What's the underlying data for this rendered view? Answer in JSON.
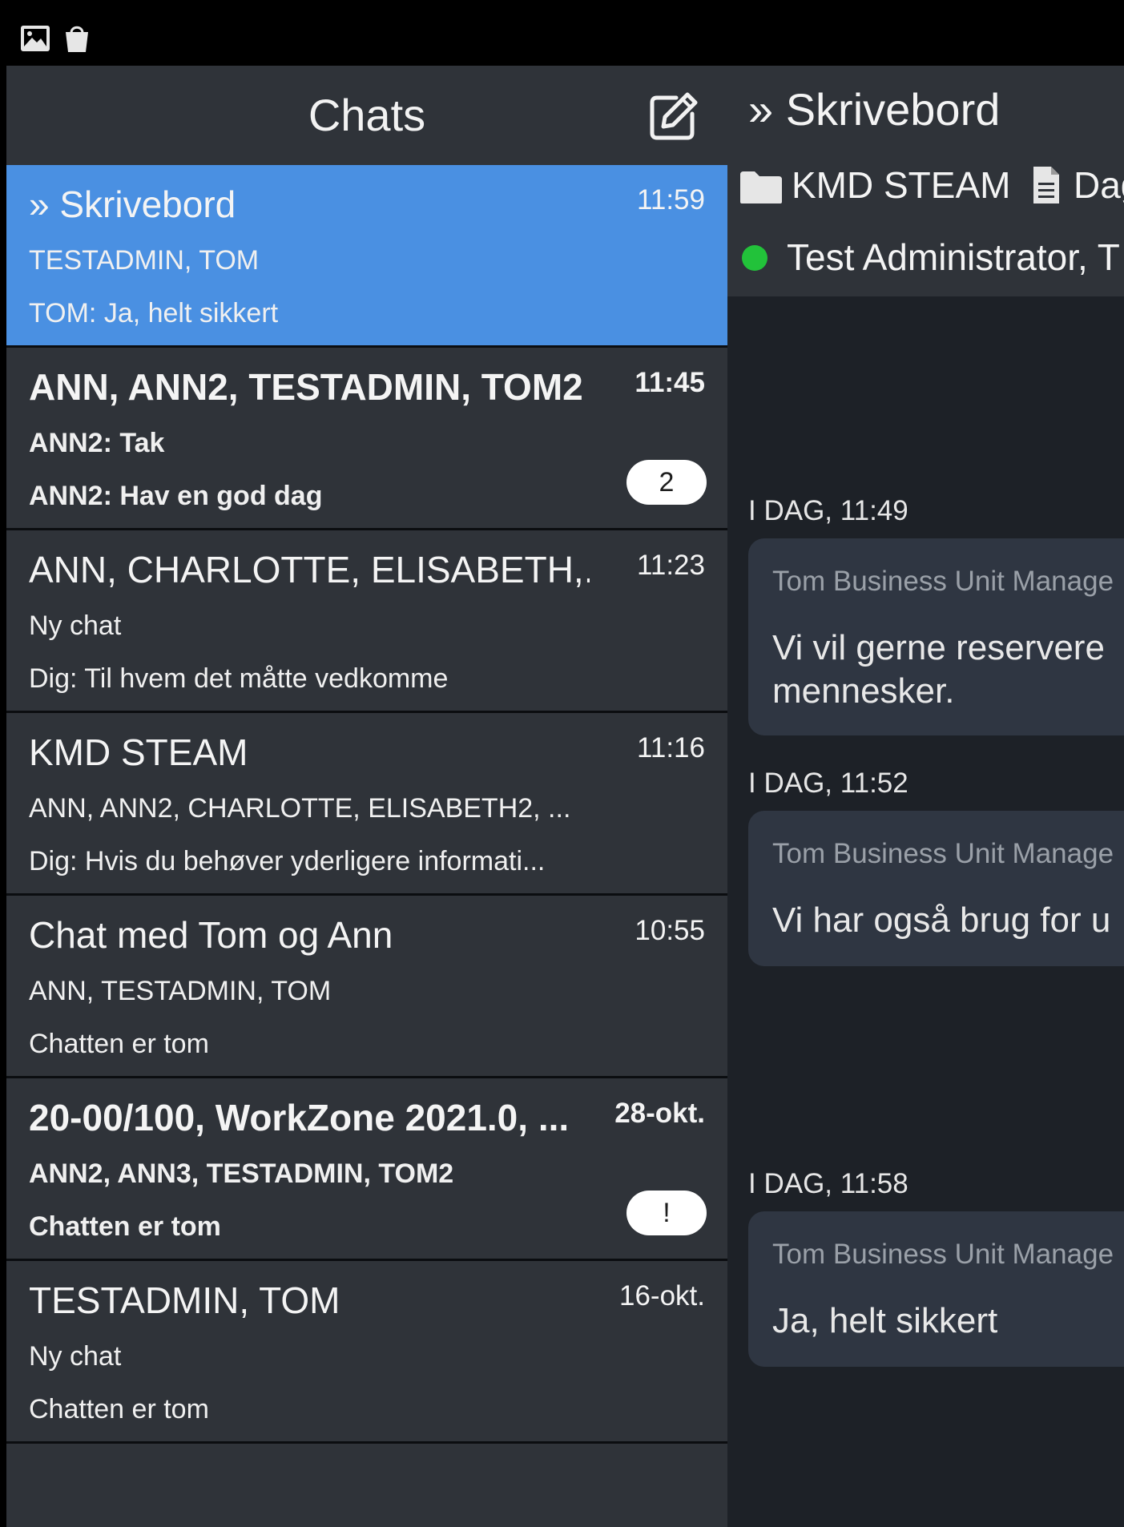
{
  "left": {
    "title": "Chats"
  },
  "chats": [
    {
      "title": "» Skrivebord",
      "time": "11:59",
      "line1": "TESTADMIN, TOM",
      "line2": "TOM: Ja, helt sikkert",
      "selected": true
    },
    {
      "title": "ANN, ANN2, TESTADMIN, TOM2",
      "time": "11:45",
      "line1": "ANN2: Tak",
      "line2": "ANN2: Hav en god dag",
      "badge": "2",
      "unread": true
    },
    {
      "title": "ANN, CHARLOTTE, ELISABETH,...",
      "time": "11:23",
      "line1": "Ny chat",
      "line2": "Dig: Til hvem det måtte vedkomme"
    },
    {
      "title": "KMD STEAM",
      "time": "11:16",
      "line1": "ANN, ANN2, CHARLOTTE, ELISABETH2, ...",
      "line2": "Dig: Hvis du behøver yderligere informati..."
    },
    {
      "title": "Chat med Tom og Ann",
      "time": "10:55",
      "line1": "ANN, TESTADMIN, TOM",
      "line2": "Chatten er tom"
    },
    {
      "title": "20-00/100, WorkZone 2021.0, ...",
      "time": "28-okt.",
      "line1": "ANN2, ANN3, TESTADMIN, TOM2",
      "line2": "Chatten er tom",
      "badge": "!",
      "unread": true
    },
    {
      "title": "TESTADMIN, TOM",
      "time": "16-okt.",
      "line1": "Ny chat",
      "line2": "Chatten er tom"
    }
  ],
  "conversation": {
    "title": "» Skrivebord",
    "folder_label": "KMD STEAM",
    "doc_label": "Dag",
    "participants": "Test Administrator, T",
    "presence_color": "#22c23a",
    "messages": [
      {
        "date": "I DAG, 11:49",
        "sender": "Tom Business Unit Manage",
        "text": "Vi vil gerne reservere\nmennesker."
      },
      {
        "date": "I DAG, 11:52",
        "sender": "Tom Business Unit Manage",
        "text": "Vi har også brug for u"
      },
      {
        "date": "I DAG, 11:58",
        "sender": "Tom Business Unit Manage",
        "text": "Ja, helt sikkert"
      }
    ]
  },
  "colors": {
    "selected_bg": "#4a90e2",
    "panel_bg": "#2f3339",
    "bubble_bg": "#2f3642"
  },
  "icons": {
    "status_left": "image-icon",
    "status_right": "shopping-bag-icon",
    "compose": "compose-icon",
    "folder": "folder-icon",
    "document": "document-icon"
  }
}
